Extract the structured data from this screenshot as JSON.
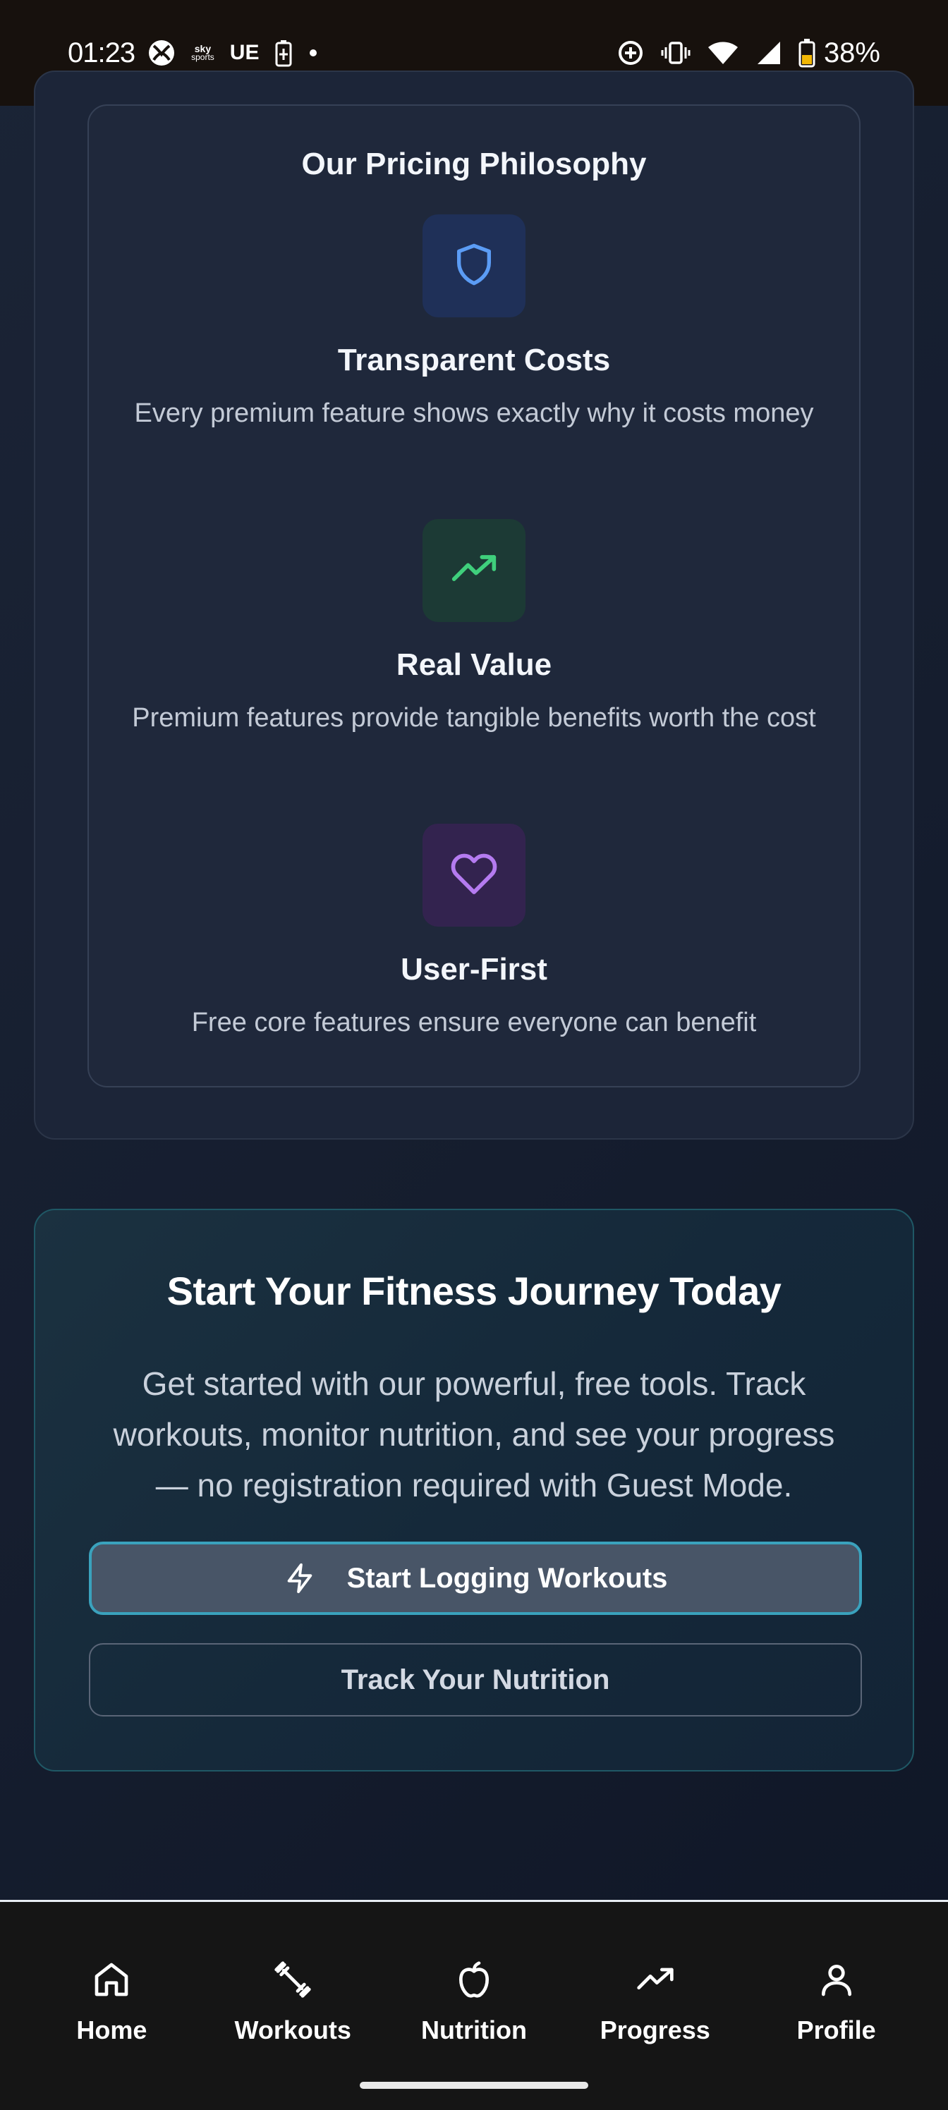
{
  "status_bar": {
    "time": "01:23",
    "sky_label_top": "sky",
    "sky_label_bottom": "sports",
    "ue_label": "UE",
    "battery_percent": "38%",
    "icons": [
      "xbox-icon",
      "sky-sports-icon",
      "ue-icon",
      "battery-saver-icon",
      "dot-icon",
      "data-saver-icon",
      "vibrate-icon",
      "wifi-icon",
      "signal-icon",
      "battery-icon"
    ]
  },
  "philosophy": {
    "title": "Our Pricing Philosophy",
    "features": [
      {
        "icon": "shield-icon",
        "title": "Transparent Costs",
        "description": "Every premium feature shows exactly why it costs money",
        "color": "#5b9cf5"
      },
      {
        "icon": "trending-up-icon",
        "title": "Real Value",
        "description": "Premium features provide tangible benefits worth the cost",
        "color": "#3fcf7c"
      },
      {
        "icon": "heart-icon",
        "title": "User-First",
        "description": "Free core features ensure everyone can benefit",
        "color": "#b57bf0"
      }
    ]
  },
  "cta": {
    "title": "Start Your Fitness Journey Today",
    "description": "Get started with our powerful, free tools. Track workouts, monitor nutrition, and see your progress — no registration required with Guest Mode.",
    "primary_button": "Start Logging Workouts",
    "secondary_button": "Track Your Nutrition"
  },
  "bottom_nav": {
    "items": [
      {
        "icon": "home-icon",
        "label": "Home"
      },
      {
        "icon": "dumbbell-icon",
        "label": "Workouts"
      },
      {
        "icon": "apple-icon",
        "label": "Nutrition"
      },
      {
        "icon": "trending-up-icon",
        "label": "Progress"
      },
      {
        "icon": "user-icon",
        "label": "Profile"
      }
    ]
  },
  "colors": {
    "accent_border": "#3aa2bd",
    "status_bar_bg": "#17110d",
    "page_bg": "#1b2436"
  }
}
